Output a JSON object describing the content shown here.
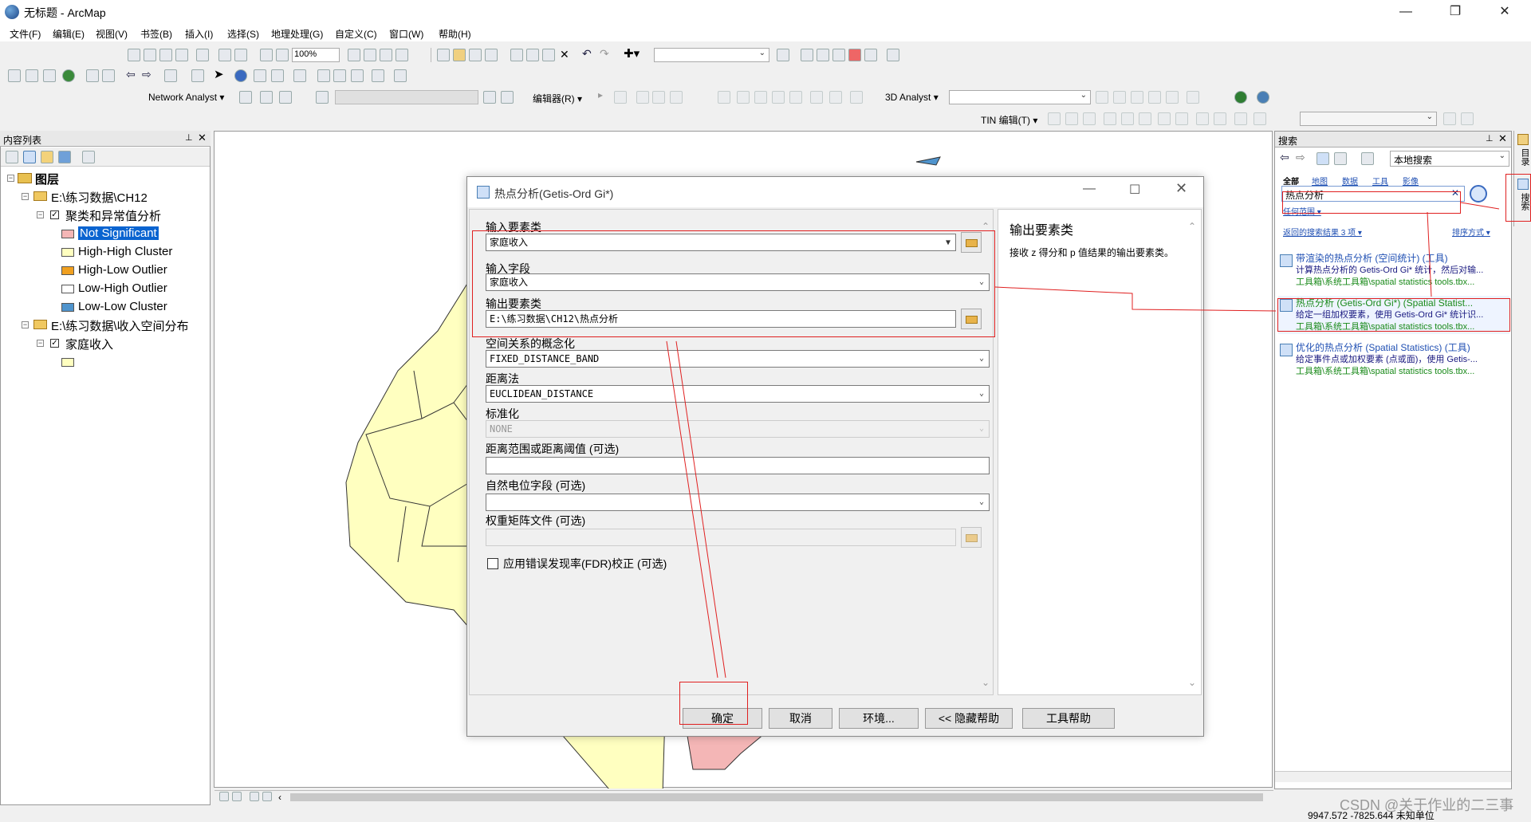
{
  "window": {
    "title": "无标题 - ArcMap"
  },
  "menu": [
    "文件(F)",
    "编辑(E)",
    "视图(V)",
    "书签(B)",
    "插入(I)",
    "选择(S)",
    "地理处理(G)",
    "自定义(C)",
    "窗口(W)",
    "帮助(H)"
  ],
  "toolbar": {
    "zoom_value": "100%",
    "network_analyst": "Network Analyst ▾",
    "editor": "编辑器(R) ▾",
    "analyst_3d": "3D Analyst ▾",
    "tin_edit": "TIN 编辑(T) ▾"
  },
  "toc": {
    "header": "内容列表",
    "root": "图层",
    "group1": "E:\\练习数据\\CH12",
    "layer1": "聚类和异常值分析",
    "legend": [
      "Not Significant",
      "High-High Cluster",
      "High-Low Outlier",
      "Low-High Outlier",
      "Low-Low Cluster"
    ],
    "legend_colors": [
      "#f4b6b6",
      "#ffffc0",
      "#f0a020",
      "#ffffff",
      "#4f94cd"
    ],
    "group2": "E:\\练习数据\\收入空间分布",
    "layer2": "家庭收入"
  },
  "dialog": {
    "title": "热点分析(Getis-Ord Gi*)",
    "fields": {
      "input_features_label": "输入要素类",
      "input_features_value": "家庭收入",
      "input_field_label": "输入字段",
      "input_field_value": "家庭收入",
      "output_label": "输出要素类",
      "output_value": "E:\\练习数据\\CH12\\热点分析",
      "conceptualization_label": "空间关系的概念化",
      "conceptualization_value": "FIXED_DISTANCE_BAND",
      "distance_method_label": "距离法",
      "distance_method_value": "EUCLIDEAN_DISTANCE",
      "standardization_label": "标准化",
      "standardization_value": "NONE",
      "distance_band_label": "距离范围或距离阈值 (可选)",
      "self_potential_label": "自然电位字段 (可选)",
      "weights_matrix_label": "权重矩阵文件 (可选)",
      "fdr_label": "应用错误发现率(FDR)校正 (可选)"
    },
    "help": {
      "title": "输出要素类",
      "body": "接收 z 得分和 p 值结果的输出要素类。"
    },
    "buttons": {
      "ok": "确定",
      "cancel": "取消",
      "env": "环境...",
      "hide_help": "<< 隐藏帮助",
      "tool_help": "工具帮助"
    }
  },
  "search": {
    "header": "搜索",
    "scope": "本地搜索",
    "tabs": [
      "全部",
      "地图",
      "数据",
      "工具",
      "影像"
    ],
    "query": "热点分析",
    "search_scope_link": "任何范围 ▾",
    "result_count": "返回的搜索结果 3 项 ▾",
    "sort": "排序方式 ▾",
    "results": [
      {
        "title": "带渲染的热点分析 (空间统计) (工具)",
        "desc": "计算热点分析的 Getis-Ord Gi* 统计，然后对输...",
        "path": "工具箱\\系统工具箱\\spatial statistics tools.tbx..."
      },
      {
        "title": "热点分析 (Getis-Ord Gi*) (Spatial Statist...",
        "desc": "给定一组加权要素，使用 Getis-Ord Gi* 统计识...",
        "path": "工具箱\\系统工具箱\\spatial statistics tools.tbx..."
      },
      {
        "title": "优化的热点分析 (Spatial Statistics) (工具)",
        "desc": "给定事件点或加权要素 (点或面)，使用 Getis-...",
        "path": "工具箱\\系统工具箱\\spatial statistics tools.tbx..."
      }
    ],
    "side_tabs": [
      "目录",
      "搜索"
    ]
  },
  "status": {
    "coords": "9947.572  -7825.644 未知单位",
    "watermark": "CSDN @关于作业的二三事"
  }
}
